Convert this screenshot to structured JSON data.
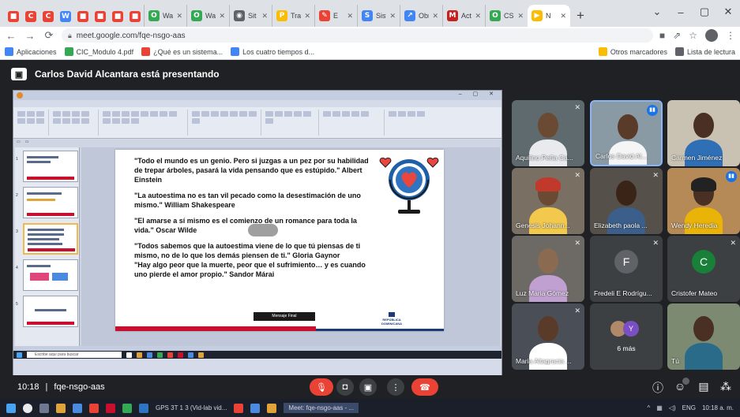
{
  "browser": {
    "tabs": [
      {
        "label": "Wasi",
        "color": "#34a853",
        "glyph": "O"
      },
      {
        "label": "Wasi",
        "color": "#34a853",
        "glyph": "O"
      },
      {
        "label": "Sit for",
        "color": "#5f6368",
        "glyph": "◉"
      },
      {
        "label": "Tras",
        "color": "#fbbc04",
        "glyph": "P"
      },
      {
        "label": "E",
        "color": "#ea4335",
        "glyph": "✎"
      },
      {
        "label": "Siste",
        "color": "#4285f4",
        "glyph": "S"
      },
      {
        "label": "Obra",
        "color": "#4285f4",
        "glyph": "↗"
      },
      {
        "label": "Activ",
        "color": "#c5221f",
        "glyph": "M"
      },
      {
        "label": "CS W",
        "color": "#34a853",
        "glyph": "O"
      },
      {
        "label": "N",
        "color": "#fbbc04",
        "glyph": "▶"
      }
    ],
    "pinned_tabs": [
      {
        "color": "#ea4335",
        "glyph": "■"
      },
      {
        "color": "#ea4335",
        "glyph": "C"
      },
      {
        "color": "#ea4335",
        "glyph": "C"
      },
      {
        "color": "#4285f4",
        "glyph": "W"
      },
      {
        "color": "#ea4335",
        "glyph": "■"
      },
      {
        "color": "#ea4335",
        "glyph": "■"
      },
      {
        "color": "#ea4335",
        "glyph": "■"
      },
      {
        "color": "#ea4335",
        "glyph": "■"
      }
    ],
    "url": "meet.google.com/fqe-nsgo-aas",
    "bookmarks": [
      {
        "label": "Aplicaciones",
        "color": "#4285f4"
      },
      {
        "label": "CIC_Modulo 4.pdf",
        "color": "#34a853"
      },
      {
        "label": "¿Qué es un sistema...",
        "color": "#ea4335"
      },
      {
        "label": "Los cuatro tiempos d...",
        "color": "#4285f4"
      }
    ],
    "bookmarks_right": [
      {
        "label": "Otros marcadores",
        "color": "#fbbc04"
      },
      {
        "label": "Lista de lectura",
        "color": "#5f6368"
      }
    ]
  },
  "meet": {
    "presenter_text": "Carlos David Alcantara está presentando",
    "meeting_time": "10:18",
    "meeting_code": "fqe-nsgo-aas",
    "participants": [
      {
        "name": "Aquilino Peña Ca...",
        "muted": true
      },
      {
        "name": "Carlos David Al...",
        "speaking": true,
        "selected": true
      },
      {
        "name": "Carmen Jiménez",
        "muted": false
      },
      {
        "name": "Genesis Johann...",
        "muted": true
      },
      {
        "name": "Elizabeth paola ...",
        "muted": true
      },
      {
        "name": "Wendy Heredia",
        "speaking": true
      },
      {
        "name": "Luz Maria Gómez",
        "muted": true
      },
      {
        "name": "Fredeli E Rodrígu...",
        "muted": true,
        "initial": "F",
        "avatar_color": "#5f6368"
      },
      {
        "name": "Cristofer Mateo",
        "muted": true,
        "initial": "C",
        "avatar_color": "#188038"
      },
      {
        "name": "Maria Altagracia ...",
        "muted": true
      },
      {
        "name": "6 más",
        "more": true,
        "initial": "Y"
      },
      {
        "name": "Tú",
        "self": true
      }
    ]
  },
  "slide": {
    "quotes": [
      "\"Todo el mundo es un genio. Pero si juzgas a un pez por su habilidad de trepar árboles, pasará la vida pensando que es estúpido.\" Albert Einstein",
      "\"La autoestima no es tan vil pecado como la desestimación de uno mismo.\" William Shakespeare",
      "\"El amarse a sí mismo es el comienzo de un romance para toda la vida.\" Oscar Wilde",
      "\"Todos sabemos que la autoestima viene de lo que tú piensas de ti mismo, no de lo que los demás piensen de ti.\" Gloria Gaynor\n\"Hay algo peor que la muerte, peor que el sufrimiento… y es cuando uno pierde el amor propio.\" Sandor Márai"
    ],
    "button_label": "Mensaje Final",
    "logo_text": "REPÚBLICA DOMINICANA"
  },
  "taskbar": {
    "search_placeholder": "Escribe aquí para buscar",
    "apps_text": "GPS 3T 1 3 (Vid-lab vid...",
    "meet_text": "Meet: fqe-nsgo-aas - ...",
    "lang": "ENG",
    "time": "10:18 a. m."
  },
  "colors": {
    "meet_bg": "#202124",
    "tile_bg": "#3c4043",
    "danger": "#ea4335",
    "slide_red": "#c8102e",
    "slide_blue": "#1c3a78"
  }
}
